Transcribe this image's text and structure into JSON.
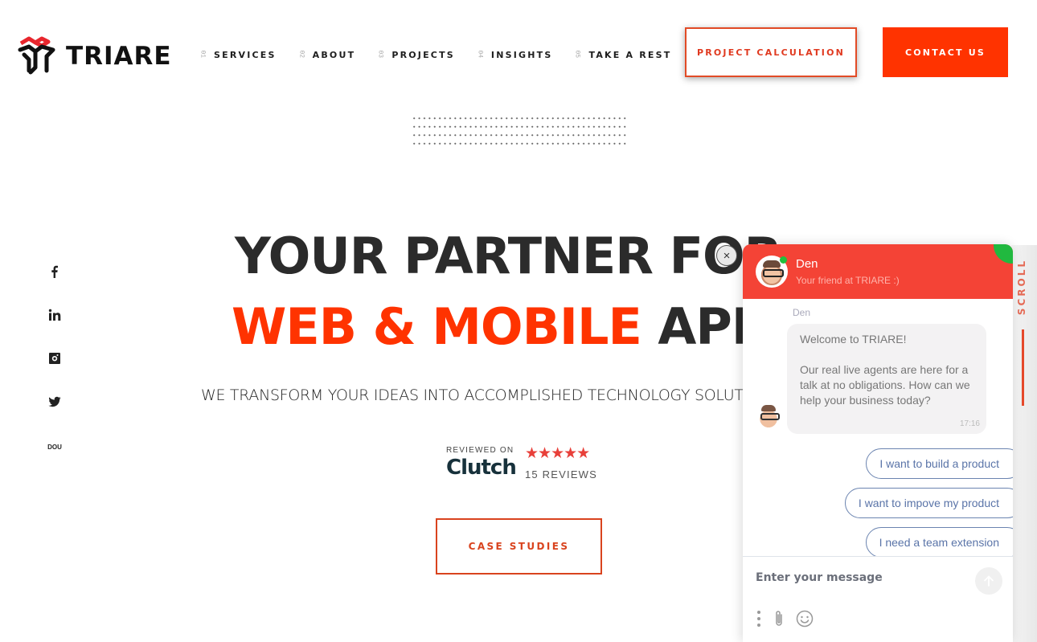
{
  "brand": {
    "name": "TRIARE",
    "accent": "#ff3300",
    "logo_red": "#e8262d"
  },
  "nav": {
    "items": [
      {
        "num": "01",
        "label": "SERVICES"
      },
      {
        "num": "02",
        "label": "ABOUT"
      },
      {
        "num": "03",
        "label": "PROJECTS"
      },
      {
        "num": "04",
        "label": "INSIGHTS"
      },
      {
        "num": "05",
        "label": "TAKE A REST"
      }
    ],
    "calc_button": "PROJECT CALCULATION",
    "contact_button": "CONTACT US"
  },
  "social": {
    "items": [
      {
        "icon": "facebook-icon"
      },
      {
        "icon": "linkedin-icon"
      },
      {
        "icon": "instagram-icon"
      },
      {
        "icon": "twitter-icon"
      },
      {
        "icon": "dou-icon",
        "label": "DOU"
      }
    ]
  },
  "hero": {
    "line1": "YOUR PARTNER FOR",
    "line2_accent": "WEB & MOBILE",
    "line2_rest": " APPS",
    "subtitle": "WE TRANSFORM YOUR IDEAS INTO ACCOMPLISHED TECHNOLOGY SOLUTIONS",
    "cta": "CASE STUDIES"
  },
  "clutch": {
    "reviewed_on": "REVIEWED ON",
    "logo": "Clutch",
    "stars": "★★★★★",
    "rating": 5,
    "reviews": "15 REVIEWS"
  },
  "scroll": {
    "label": "SCROLL"
  },
  "chat": {
    "agent_name": "Den",
    "agent_subtitle": "Your friend at TRIARE :)",
    "online": true,
    "sender": "Den",
    "message_p1": "Welcome to TRIARE!",
    "message_p2": "Our real live agents are here for a talk at no obligations. How can we help your business today?",
    "time": "17:16",
    "quick_replies": [
      "I want to build a product",
      "I want to impove my product",
      "I need a team extension"
    ],
    "input_placeholder": "Enter your message",
    "close_label": "×"
  }
}
